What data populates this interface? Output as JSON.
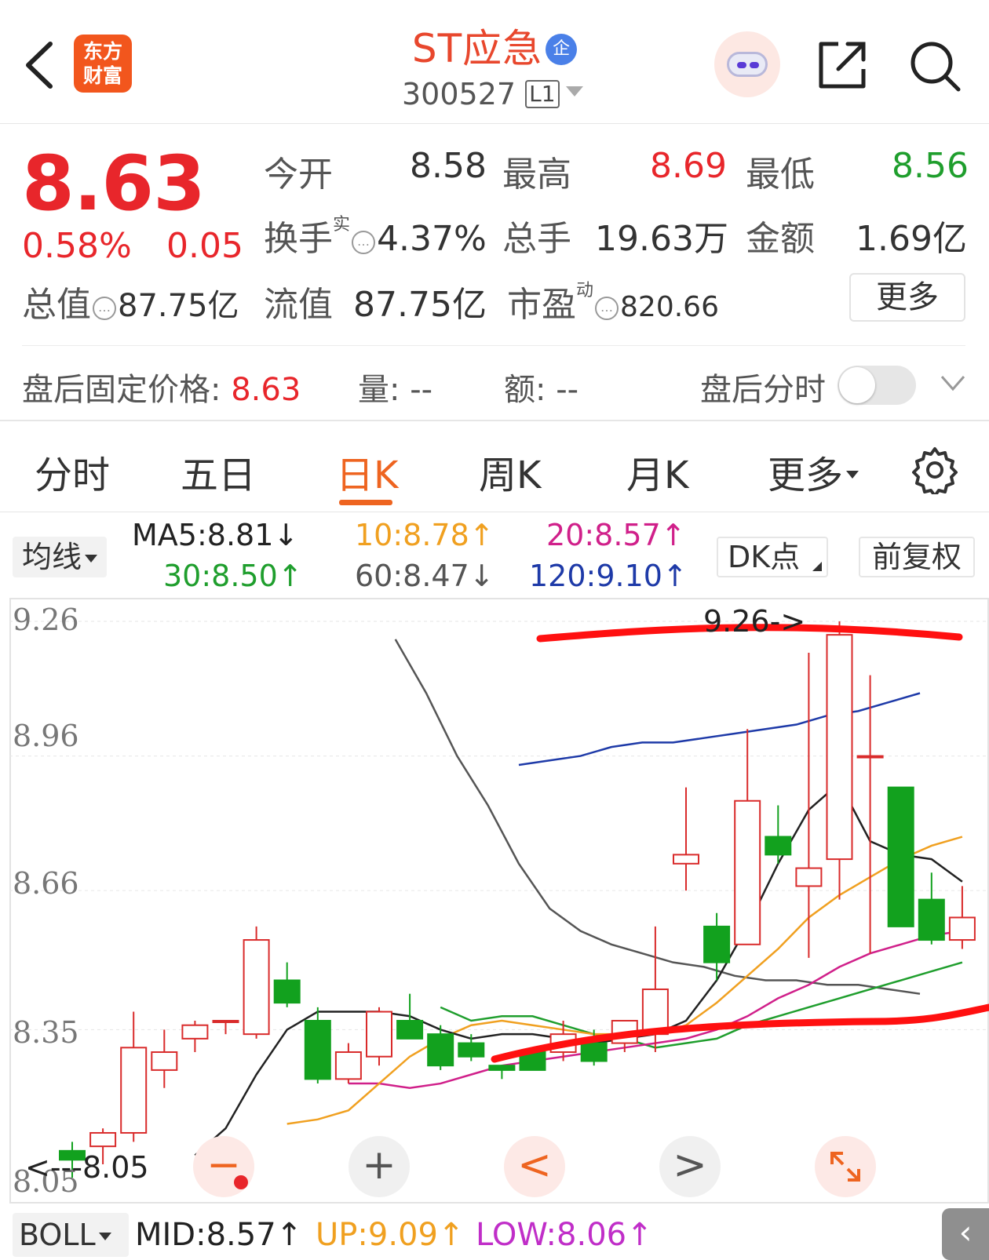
{
  "header": {
    "logo_line1": "东方",
    "logo_line2": "财富",
    "stock_name": "ST应急",
    "enterprise_badge": "企",
    "stock_code": "300527",
    "level": "L1"
  },
  "quote": {
    "price": "8.63",
    "change_pct": "0.58%",
    "change": "0.05",
    "open_label": "今开",
    "open": "8.58",
    "high_label": "最高",
    "high": "8.69",
    "low_label": "最低",
    "low": "8.56",
    "turnover_label": "换手",
    "turnover_sup": "实",
    "turnover": "4.37%",
    "volume_label": "总手",
    "volume": "19.63万",
    "amount_label": "金额",
    "amount": "1.69亿",
    "mktcap_label": "总值",
    "mktcap": "87.75亿",
    "float_label": "流值",
    "float": "87.75亿",
    "pe_label": "市盈",
    "pe_sup": "动",
    "pe": "820.66",
    "more": "更多"
  },
  "after_hours": {
    "price_label": "盘后固定价格:",
    "price": "8.63",
    "volume_label": "量:",
    "volume": "--",
    "amount_label": "额:",
    "amount": "--",
    "toggle_label": "盘后分时"
  },
  "tabs": [
    "分时",
    "五日",
    "日K",
    "周K",
    "月K",
    "更多"
  ],
  "indicators": {
    "ma_select": "均线",
    "ma5": "MA5:8.81↓",
    "ma10": "10:8.78↑",
    "ma20": "20:8.57↑",
    "ma30": "30:8.50↑",
    "ma60": "60:8.47↓",
    "ma120": "120:9.10↑",
    "dk": "DK点",
    "fq": "前复权",
    "colors": {
      "ma5": "#222222",
      "ma10": "#f0a020",
      "ma20": "#d0208a",
      "ma30": "#1f9e2d",
      "ma60": "#555555",
      "ma120": "#1e3aa8"
    }
  },
  "chart": {
    "y_labels": [
      "9.26",
      "8.96",
      "8.66",
      "8.35",
      "8.05"
    ],
    "high_marker": "9.26->",
    "low_marker": "<---8.05",
    "controls": [
      "−",
      "+",
      "<",
      ">",
      "expand-icon"
    ]
  },
  "chart_data": {
    "type": "candlestick",
    "ylim": [
      8.05,
      9.26
    ],
    "candles": [
      {
        "o": 8.08,
        "h": 8.1,
        "l": 8.02,
        "c": 8.06
      },
      {
        "o": 8.09,
        "h": 8.13,
        "l": 8.05,
        "c": 8.12
      },
      {
        "o": 8.12,
        "h": 8.39,
        "l": 8.1,
        "c": 8.31
      },
      {
        "o": 8.26,
        "h": 8.35,
        "l": 8.22,
        "c": 8.3
      },
      {
        "o": 8.33,
        "h": 8.37,
        "l": 8.3,
        "c": 8.36
      },
      {
        "o": 8.37,
        "h": 8.34,
        "l": 8.34,
        "c": 8.37
      },
      {
        "o": 8.34,
        "h": 8.58,
        "l": 8.33,
        "c": 8.55
      },
      {
        "o": 8.46,
        "h": 8.5,
        "l": 8.4,
        "c": 8.41
      },
      {
        "o": 8.37,
        "h": 8.4,
        "l": 8.23,
        "c": 8.24
      },
      {
        "o": 8.24,
        "h": 8.32,
        "l": 8.23,
        "c": 8.3
      },
      {
        "o": 8.29,
        "h": 8.4,
        "l": 8.27,
        "c": 8.39
      },
      {
        "o": 8.37,
        "h": 8.43,
        "l": 8.33,
        "c": 8.33
      },
      {
        "o": 8.34,
        "h": 8.36,
        "l": 8.26,
        "c": 8.27
      },
      {
        "o": 8.32,
        "h": 8.34,
        "l": 8.28,
        "c": 8.29
      },
      {
        "o": 8.27,
        "h": 8.27,
        "l": 8.24,
        "c": 8.26
      },
      {
        "o": 8.3,
        "h": 8.3,
        "l": 8.26,
        "c": 8.26
      },
      {
        "o": 8.3,
        "h": 8.37,
        "l": 8.28,
        "c": 8.34
      },
      {
        "o": 8.32,
        "h": 8.35,
        "l": 8.27,
        "c": 8.28
      },
      {
        "o": 8.32,
        "h": 8.36,
        "l": 8.3,
        "c": 8.37
      },
      {
        "o": 8.34,
        "h": 8.58,
        "l": 8.3,
        "c": 8.44
      },
      {
        "o": 8.72,
        "h": 8.89,
        "l": 8.66,
        "c": 8.74
      },
      {
        "o": 8.58,
        "h": 8.61,
        "l": 8.46,
        "c": 8.5
      },
      {
        "o": 8.54,
        "h": 9.02,
        "l": 8.54,
        "c": 8.86
      },
      {
        "o": 8.78,
        "h": 8.85,
        "l": 8.72,
        "c": 8.74
      },
      {
        "o": 8.67,
        "h": 9.19,
        "l": 8.51,
        "c": 8.71
      },
      {
        "o": 8.73,
        "h": 9.26,
        "l": 8.64,
        "c": 9.23
      },
      {
        "o": 8.96,
        "h": 9.14,
        "l": 8.52,
        "c": 8.96
      },
      {
        "o": 8.89,
        "h": 8.89,
        "l": 8.58,
        "c": 8.58
      },
      {
        "o": 8.64,
        "h": 8.7,
        "l": 8.54,
        "c": 8.55
      },
      {
        "o": 8.55,
        "h": 8.67,
        "l": 8.53,
        "c": 8.6
      }
    ],
    "lines": {
      "ma5": [
        8.07,
        8.13,
        8.25,
        8.35,
        8.39,
        8.39,
        8.39,
        8.38,
        8.35,
        8.33,
        8.34,
        8.34,
        8.33,
        8.32,
        8.33,
        8.34,
        8.37,
        8.46,
        8.58,
        8.72,
        8.84,
        8.9,
        8.77,
        8.74,
        8.73,
        8.68
      ],
      "ma10": [
        8.14,
        8.15,
        8.17,
        8.23,
        8.29,
        8.33,
        8.36,
        8.37,
        8.36,
        8.35,
        8.34,
        8.34,
        8.34,
        8.36,
        8.41,
        8.47,
        8.53,
        8.6,
        8.65,
        8.69,
        8.73,
        8.76,
        8.78
      ],
      "ma20": [
        8.23,
        8.23,
        8.22,
        8.23,
        8.25,
        8.27,
        8.28,
        8.29,
        8.3,
        8.31,
        8.32,
        8.33,
        8.35,
        8.38,
        8.42,
        8.45,
        8.49,
        8.52,
        8.54,
        8.56,
        8.57
      ],
      "ma30": [
        8.4,
        8.37,
        8.38,
        8.38,
        8.36,
        8.34,
        8.33,
        8.31,
        8.32,
        8.33,
        8.36,
        8.38,
        8.4,
        8.42,
        8.44,
        8.46,
        8.48,
        8.5
      ],
      "ma60": [
        9.22,
        9.1,
        8.96,
        8.85,
        8.72,
        8.62,
        8.57,
        8.54,
        8.52,
        8.5,
        8.49,
        8.47,
        8.46,
        8.46,
        8.45,
        8.45,
        8.44,
        8.43
      ],
      "ma120": [
        8.94,
        8.95,
        8.96,
        8.98,
        8.99,
        8.99,
        9.0,
        9.01,
        9.02,
        9.03,
        9.05,
        9.06,
        9.08,
        9.1
      ]
    }
  },
  "boll": {
    "select": "BOLL",
    "mid": "MID:8.57↑",
    "up": "UP:9.09↑",
    "low": "LOW:8.06↑",
    "colors": {
      "mid": "#222222",
      "up": "#f0a020",
      "low": "#c02ec8"
    }
  }
}
